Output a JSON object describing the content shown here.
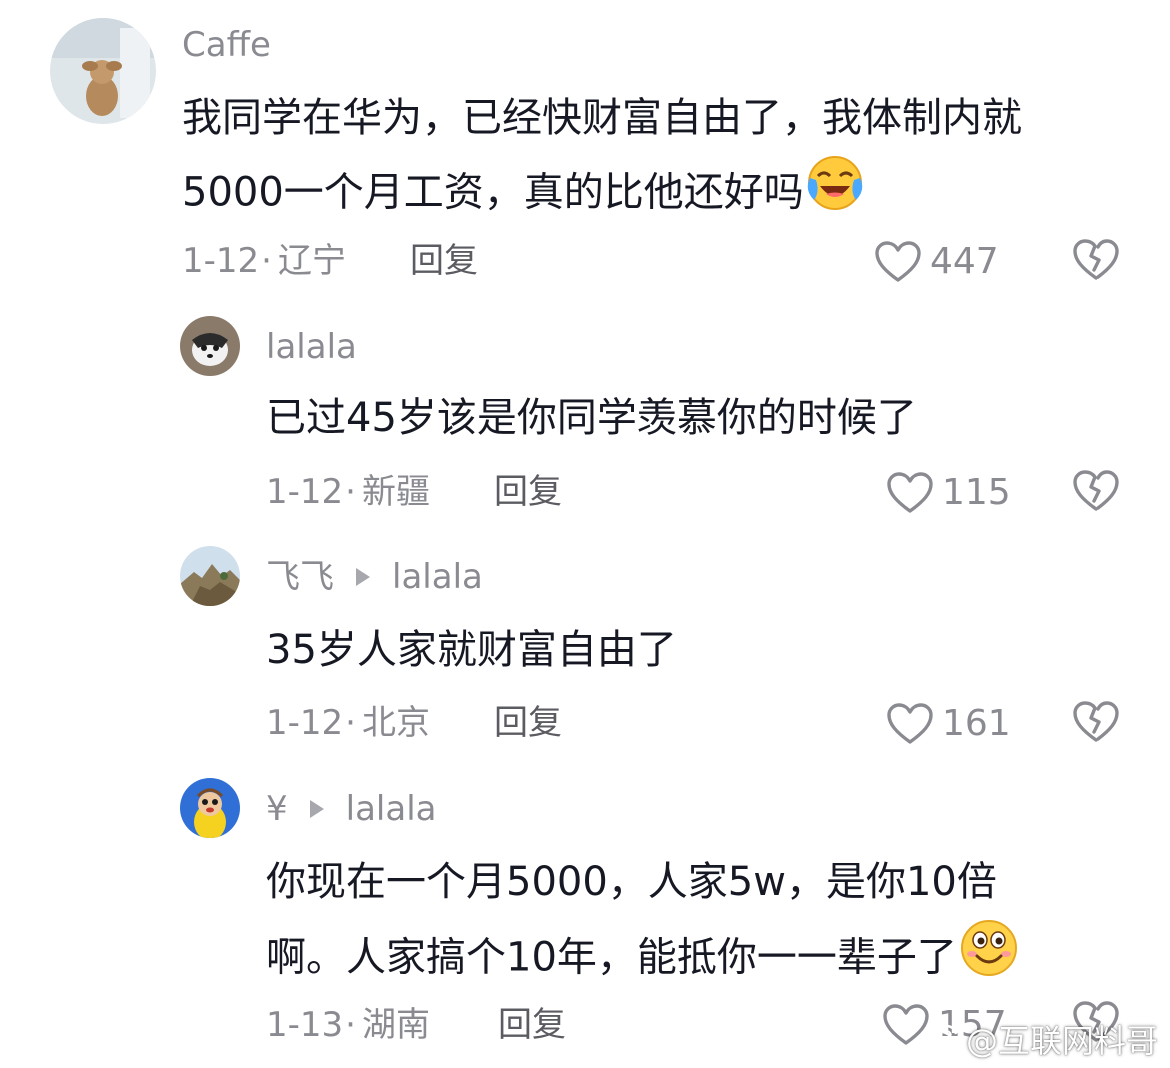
{
  "comments": [
    {
      "user": "Caffe",
      "lines": [
        "我同学在华为，已经快财富自由了，我体制内就",
        "5000一个月工资，真的比他还好吗"
      ],
      "emoji": "laughing-tears-emoji",
      "date": "1-12",
      "location": "辽宁",
      "reply_label": "回复",
      "likes": "447"
    },
    {
      "user": "lalala",
      "lines": [
        "已过45岁该是你同学羡慕你的时候了"
      ],
      "date": "1-12",
      "location": "新疆",
      "reply_label": "回复",
      "likes": "115"
    },
    {
      "user": "飞飞",
      "reply_to": "lalala",
      "lines": [
        "35岁人家就财富自由了"
      ],
      "date": "1-12",
      "location": "北京",
      "reply_label": "回复",
      "likes": "161"
    },
    {
      "user": "¥",
      "reply_to": "lalala",
      "lines": [
        "你现在一个月5000，人家5w，是你10倍",
        "啊。人家搞个10年，能抵你一一辈子了"
      ],
      "emoji": "grinning-emoji",
      "date": "1-13",
      "location": "湖南",
      "reply_label": "回复",
      "likes": "157"
    }
  ],
  "watermark": "@互联网料哥",
  "colors": {
    "text": "#161823",
    "muted": "#8a8b91",
    "reply": "#5b5c62"
  }
}
